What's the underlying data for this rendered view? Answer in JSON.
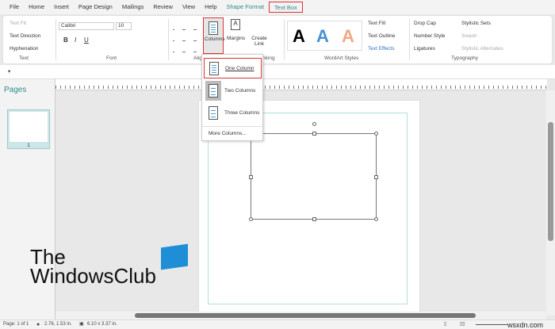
{
  "menu": [
    "File",
    "Home",
    "Insert",
    "Page Design",
    "Mailings",
    "Review",
    "View",
    "Help",
    "Shape Format",
    "Text Box"
  ],
  "ribbon": {
    "text_group": {
      "label": "Text",
      "text_fit": "Text Fit",
      "text_direction": "Text Direction",
      "hyphenation": "Hyphenation"
    },
    "font_group": {
      "label": "Font",
      "font": "Calibri",
      "size": "10"
    },
    "alignment_group": {
      "label": "Alignment"
    },
    "columns": "Columns",
    "margins": "Margins",
    "create_link": "Create Link",
    "linking_label": "Linking",
    "wordart": {
      "label": "WordArt Styles",
      "text_fill": "Text Fill",
      "text_outline": "Text Outline",
      "text_effects": "Text Effects",
      "samples": [
        "A",
        "A",
        "A"
      ],
      "colors": [
        "#000000",
        "#4a8fd4",
        "#f0a880"
      ]
    },
    "typography": {
      "label": "Typography",
      "drop_cap": "Drop Cap",
      "number_style": "Number Style",
      "ligatures": "Ligatures",
      "stylistic_sets": "Stylistic Sets",
      "swash": "Swash",
      "stylistic_alternates": "Stylistic Alternates"
    }
  },
  "columns_menu": {
    "items": [
      "One Column",
      "Two Columns",
      "Three Columns"
    ],
    "more": "More Columns..."
  },
  "pages_pane": {
    "title": "Pages",
    "thumb_number": "1"
  },
  "status": {
    "page": "Page: 1 of 1",
    "position": "2.76, 1.53 in.",
    "size": "6.10 x 3.37 in."
  },
  "watermark": {
    "logo_line1": "The",
    "logo_line2": "WindowsClub",
    "site": "wsxdn.com"
  },
  "accent": "#2e8b8b",
  "highlight": "#dd3333"
}
